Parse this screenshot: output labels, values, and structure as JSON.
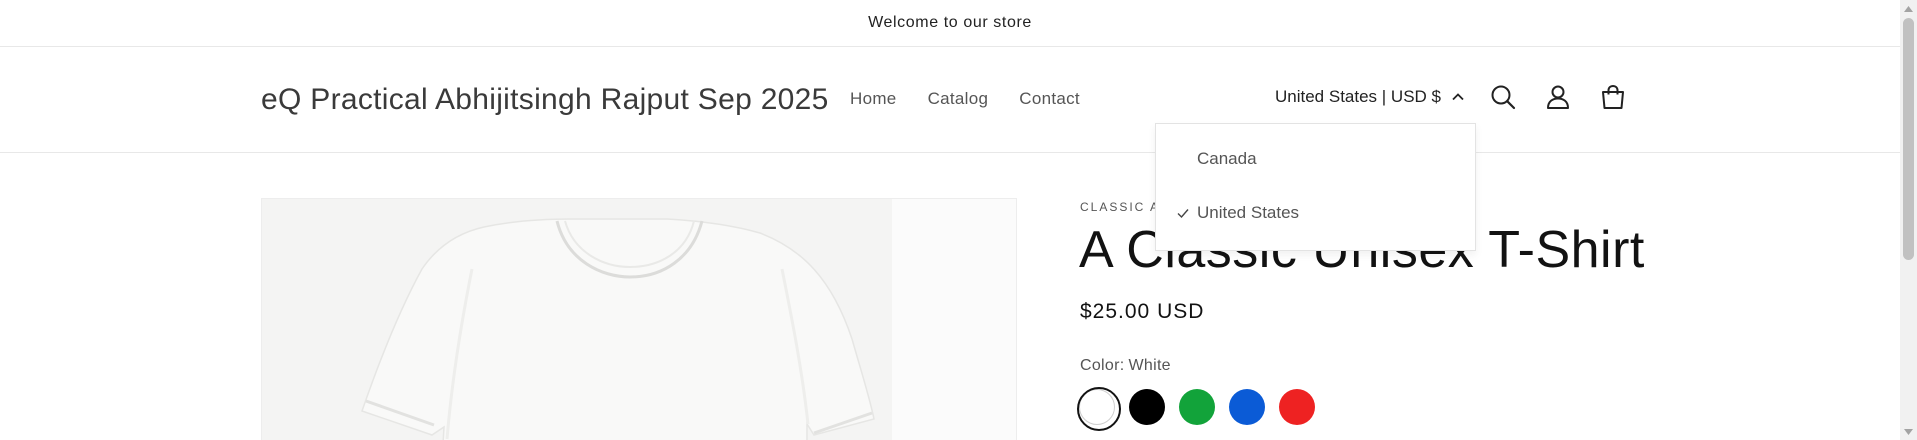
{
  "announcement": {
    "text": "Welcome to our store"
  },
  "header": {
    "logo": "eQ Practical Abhijitsingh Rajput Sep 2025",
    "nav": [
      {
        "label": "Home"
      },
      {
        "label": "Catalog"
      },
      {
        "label": "Contact"
      }
    ],
    "localization": {
      "label": "United States | USD $",
      "expanded": true,
      "icon": "chevron-up-icon"
    },
    "icons": [
      "search-icon",
      "account-icon",
      "cart-icon"
    ]
  },
  "country_dropdown": {
    "options": [
      {
        "label": "Canada",
        "selected": false
      },
      {
        "label": "United States",
        "selected": true
      }
    ]
  },
  "product": {
    "vendor": "CLASSIC AP",
    "title": "A Classic Unisex T-Shirt",
    "price": "$25.00 USD",
    "color_label": "Color:",
    "color_value": "White",
    "swatches": [
      {
        "name": "White",
        "color": "#ffffff",
        "selected": true
      },
      {
        "name": "Black",
        "color": "#000000",
        "selected": false
      },
      {
        "name": "Green",
        "color": "#12a33a",
        "selected": false
      },
      {
        "name": "Blue",
        "color": "#0b5bd6",
        "selected": false
      },
      {
        "name": "Red",
        "color": "#ee2222",
        "selected": false
      }
    ]
  }
}
